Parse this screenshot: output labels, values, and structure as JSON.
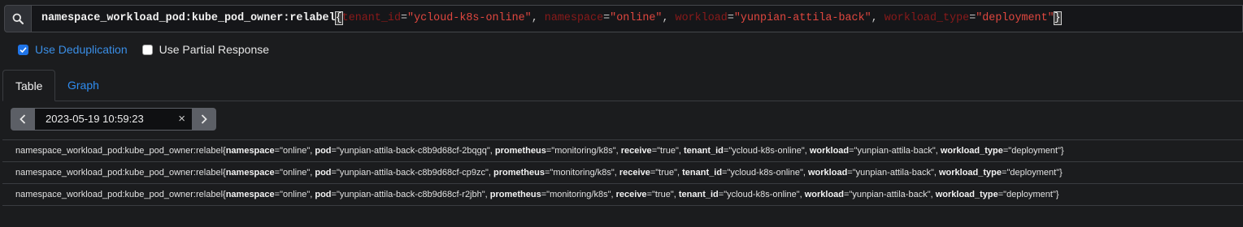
{
  "query": {
    "metric": "namespace_workload_pod:kube_pod_owner:relabel",
    "open_brace": "{",
    "close_brace": "}",
    "matchers": [
      {
        "label": "tenant_id",
        "op": "=",
        "value": "\"ycloud-k8s-online\"",
        "sep": ", "
      },
      {
        "label": "namespace",
        "op": "=",
        "value": "\"online\"",
        "sep": ", "
      },
      {
        "label": "workload",
        "op": "=",
        "value": "\"yunpian-attila-back\"",
        "sep": ", "
      },
      {
        "label": "workload_type",
        "op": "=",
        "value": "\"deployment\"",
        "sep": ""
      }
    ]
  },
  "options": {
    "dedup_label": "Use Deduplication",
    "dedup_checked": true,
    "partial_label": "Use Partial Response",
    "partial_checked": false
  },
  "tabs": {
    "table": "Table",
    "graph": "Graph",
    "active": "Table"
  },
  "time": {
    "value": "2023-05-19 10:59:23",
    "clear": "×"
  },
  "results": [
    {
      "metric": "namespace_workload_pod:kube_pod_owner:relabel",
      "labels": [
        {
          "k": "namespace",
          "v": "\"online\""
        },
        {
          "k": "pod",
          "v": "\"yunpian-attila-back-c8b9d68cf-2bqgq\""
        },
        {
          "k": "prometheus",
          "v": "\"monitoring/k8s\""
        },
        {
          "k": "receive",
          "v": "\"true\""
        },
        {
          "k": "tenant_id",
          "v": "\"ycloud-k8s-online\""
        },
        {
          "k": "workload",
          "v": "\"yunpian-attila-back\""
        },
        {
          "k": "workload_type",
          "v": "\"deployment\""
        }
      ]
    },
    {
      "metric": "namespace_workload_pod:kube_pod_owner:relabel",
      "labels": [
        {
          "k": "namespace",
          "v": "\"online\""
        },
        {
          "k": "pod",
          "v": "\"yunpian-attila-back-c8b9d68cf-cp9zc\""
        },
        {
          "k": "prometheus",
          "v": "\"monitoring/k8s\""
        },
        {
          "k": "receive",
          "v": "\"true\""
        },
        {
          "k": "tenant_id",
          "v": "\"ycloud-k8s-online\""
        },
        {
          "k": "workload",
          "v": "\"yunpian-attila-back\""
        },
        {
          "k": "workload_type",
          "v": "\"deployment\""
        }
      ]
    },
    {
      "metric": "namespace_workload_pod:kube_pod_owner:relabel",
      "labels": [
        {
          "k": "namespace",
          "v": "\"online\""
        },
        {
          "k": "pod",
          "v": "\"yunpian-attila-back-c8b9d68cf-r2jbh\""
        },
        {
          "k": "prometheus",
          "v": "\"monitoring/k8s\""
        },
        {
          "k": "receive",
          "v": "\"true\""
        },
        {
          "k": "tenant_id",
          "v": "\"ycloud-k8s-online\""
        },
        {
          "k": "workload",
          "v": "\"yunpian-attila-back\""
        },
        {
          "k": "workload_type",
          "v": "\"deployment\""
        }
      ]
    }
  ],
  "colors": {
    "accent": "#1f74e8",
    "link": "#2f8cf0",
    "label_key": "#8a1a1a",
    "string_value": "#e0473f"
  },
  "icons": {
    "search": "search-icon",
    "prev": "chevron-left-icon",
    "next": "chevron-right-icon",
    "clear": "close-icon",
    "check": "check-icon"
  }
}
